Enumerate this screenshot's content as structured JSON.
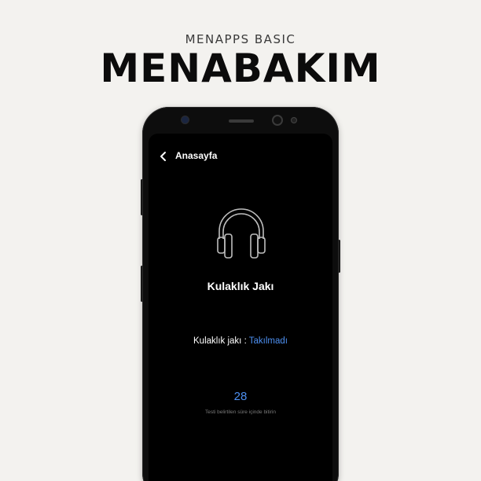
{
  "brand": {
    "subtitle": "MENAPPS BASIC",
    "title": "MENABAKIM"
  },
  "screen": {
    "back_label": "Anasayfa",
    "back_icon": "chevron-left-icon",
    "feature_icon": "headphones-icon",
    "title": "Kulaklık Jakı",
    "status_label": "Kulaklık jakı : ",
    "status_value": "Takılmadı",
    "countdown": "28",
    "hint": "Testi belirtilen süre içinde bitirin"
  },
  "colors": {
    "background": "#f3f2ef",
    "screen": "#000000",
    "accent": "#4d8ff0",
    "text_primary": "#ffffff",
    "text_muted": "#7a7a7a"
  }
}
